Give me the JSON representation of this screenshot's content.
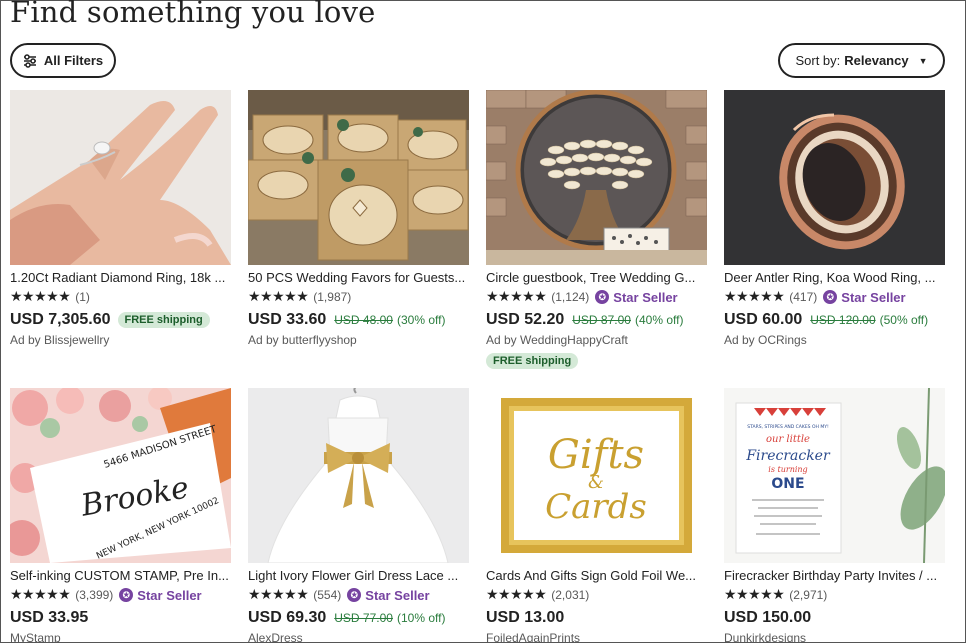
{
  "header": {
    "title": "Find something you love"
  },
  "toolbar": {
    "filters_label": "All Filters",
    "sort_prefix": "Sort by:",
    "sort_value": "Relevancy"
  },
  "listings": [
    {
      "title": "1.20Ct Radiant Diamond Ring, 18k ...",
      "stars": "★★★★★",
      "reviews": "(1)",
      "price": "USD 7,305.60",
      "free_shipping": "FREE shipping",
      "shop": "Ad by Blissjewellry"
    },
    {
      "title": "50 PCS Wedding Favors for Guests...",
      "stars": "★★★★★",
      "reviews": "(1,987)",
      "price": "USD 33.60",
      "old_price": "USD 48.00",
      "discount": "(30% off)",
      "shop": "Ad by butterflyyshop"
    },
    {
      "title": "Circle guestbook, Tree Wedding G...",
      "stars": "★★★★★",
      "reviews": "(1,124)",
      "star_seller": "Star Seller",
      "price": "USD 52.20",
      "old_price": "USD 87.00",
      "discount": "(40% off)",
      "shop": "Ad by WeddingHappyCraft",
      "free_shipping": "FREE shipping"
    },
    {
      "title": "Deer Antler Ring, Koa Wood Ring, ...",
      "stars": "★★★★★",
      "reviews": "(417)",
      "star_seller": "Star Seller",
      "price": "USD 60.00",
      "old_price": "USD 120.00",
      "discount": "(50% off)",
      "shop": "Ad by OCRings"
    },
    {
      "title": "Self-inking CUSTOM STAMP, Pre In...",
      "stars": "★★★★★",
      "reviews": "(3,399)",
      "star_seller": "Star Seller",
      "price": "USD 33.95",
      "shop": "MyStamp"
    },
    {
      "title": "Light Ivory Flower Girl Dress Lace ...",
      "stars": "★★★★★",
      "reviews": "(554)",
      "star_seller": "Star Seller",
      "price": "USD 69.30",
      "old_price": "USD 77.00",
      "discount": "(10% off)",
      "shop": "AlexDress"
    },
    {
      "title": "Cards And Gifts Sign Gold Foil We...",
      "stars": "★★★★★",
      "reviews": "(2,031)",
      "price": "USD 13.00",
      "shop": "FoiledAgainPrints"
    },
    {
      "title": "Firecracker Birthday Party Invites / ...",
      "stars": "★★★★★",
      "reviews": "(2,971)",
      "price": "USD 150.00",
      "shop": "Dunkirkdesigns"
    }
  ],
  "images": {
    "stamp_street": "5466 MADISON STREET",
    "stamp_name": "Brooke",
    "stamp_city": "NEW YORK, NEW YORK 10002",
    "sign_line1": "Gifts",
    "sign_amp": "&",
    "sign_line2": "Cards",
    "invite_top": "STARS, STRIPES AND CAKES OH MY!",
    "invite_our": "our little",
    "invite_name": "Firecracker",
    "invite_turning": "is turning",
    "invite_age": "ONE"
  },
  "colors": {
    "star_seller": "#7643a0",
    "sale_green": "#2a7c3d",
    "free_ship_bg": "#d4e9d7"
  }
}
